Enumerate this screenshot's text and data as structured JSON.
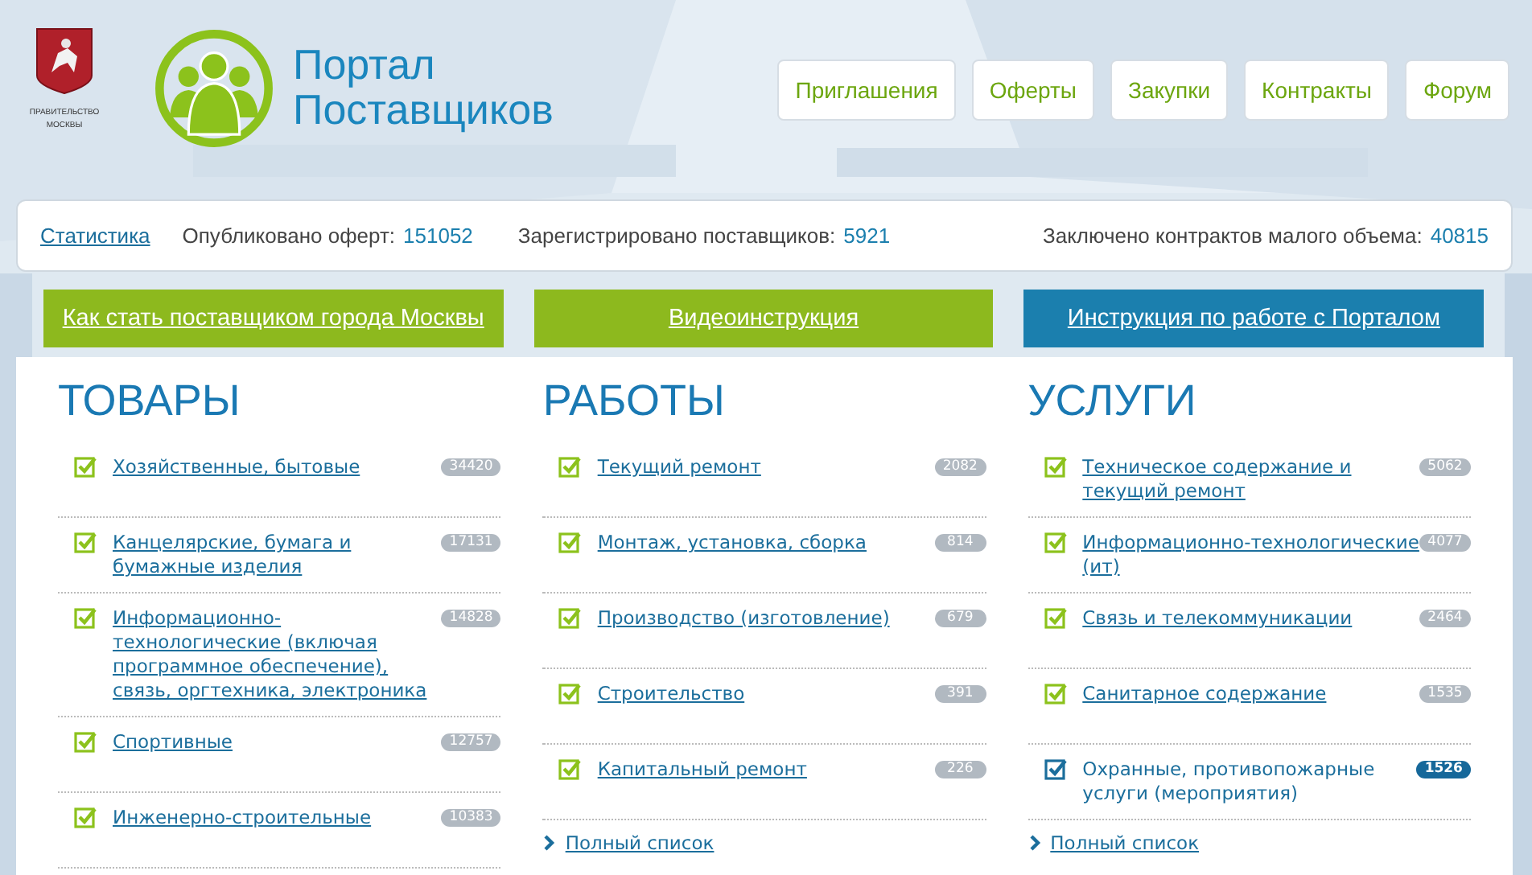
{
  "header": {
    "emblem_caption": "ПРАВИТЕЛЬСТВО МОСКВЫ",
    "logo_lines": [
      "Портал",
      "Поставщиков"
    ],
    "nav": [
      "Приглашения",
      "Оферты",
      "Закупки",
      "Контракты",
      "Форум"
    ]
  },
  "stats": {
    "link": "Статистика",
    "items": [
      {
        "label": "Опубликовано оферт:",
        "value": "151052"
      },
      {
        "label": "Зарегистрировано поставщиков:",
        "value": "5921"
      },
      {
        "label": "Заключено контрактов малого объема:",
        "value": "40815"
      }
    ]
  },
  "banners": [
    {
      "label": "Как стать поставщиком города Москвы",
      "color": "#8db91e"
    },
    {
      "label": "Видеоинструкция",
      "color": "#8db91e"
    },
    {
      "label": "Инструкция по работе с Порталом",
      "color": "#1b7fae"
    }
  ],
  "categories": [
    {
      "title": "ТОВАРЫ",
      "items": [
        {
          "label": "Хозяйственные, бытовые",
          "count": "34420",
          "selected": false
        },
        {
          "label": "Канцелярские, бумага и бумажные изделия",
          "count": "17131",
          "selected": false
        },
        {
          "label": "Информационно-технологические (включая программное обеспечение), связь, оргтехника, электроника",
          "count": "14828",
          "selected": false
        },
        {
          "label": "Спортивные",
          "count": "12757",
          "selected": false
        },
        {
          "label": "Инженерно-строительные",
          "count": "10383",
          "selected": false
        }
      ]
    },
    {
      "title": "РАБОТЫ",
      "items": [
        {
          "label": "Текущий ремонт",
          "count": "2082",
          "selected": false
        },
        {
          "label": "Монтаж, установка, сборка",
          "count": "814",
          "selected": false
        },
        {
          "label": "Производство (изготовление)",
          "count": "679",
          "selected": false
        },
        {
          "label": "Строительство",
          "count": "391",
          "selected": false
        },
        {
          "label": "Капитальный ремонт",
          "count": "226",
          "selected": false
        }
      ],
      "more": "Полный список"
    },
    {
      "title": "УСЛУГИ",
      "items": [
        {
          "label": "Техническое содержание и текущий ремонт",
          "count": "5062",
          "selected": false
        },
        {
          "label": "Информационно-технологические (ит)",
          "count": "4077",
          "selected": false
        },
        {
          "label": "Связь и телекоммуникации",
          "count": "2464",
          "selected": false
        },
        {
          "label": "Санитарное содержание",
          "count": "1535",
          "selected": false
        },
        {
          "label": "Охранные, противопожарные услуги (мероприятия)",
          "count": "1526",
          "selected": true
        }
      ],
      "more": "Полный список"
    }
  ]
}
